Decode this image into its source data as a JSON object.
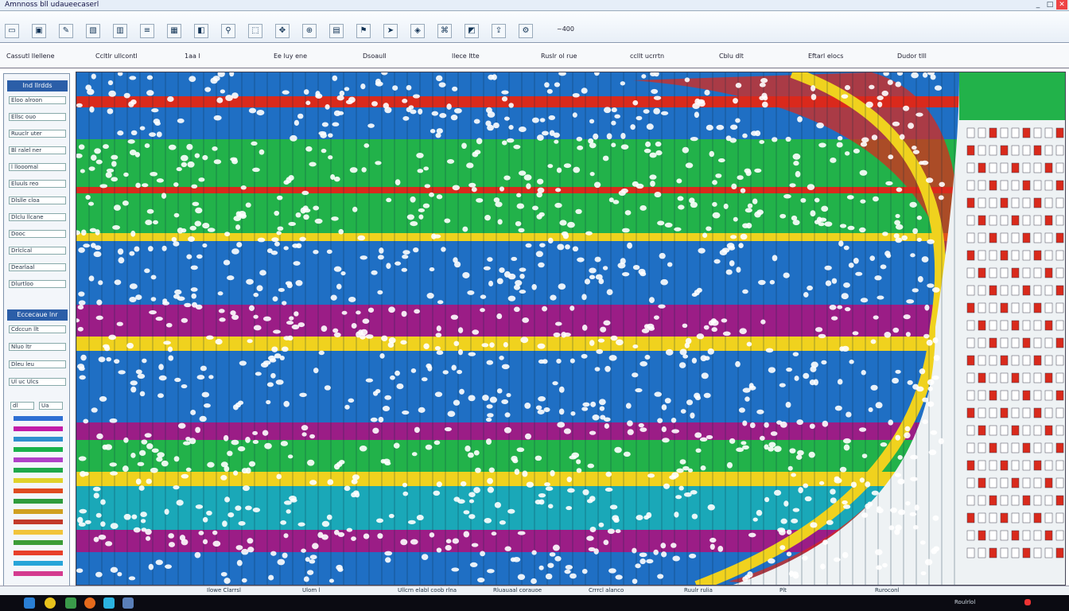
{
  "app": {
    "title": "Amnnoss bll udaueecaserl"
  },
  "window_controls": {
    "minimize": "_",
    "maximize": "□",
    "close": "✕"
  },
  "toolbar": {
    "buttons": [
      {
        "name": "new-icon",
        "glyph": "▭"
      },
      {
        "name": "save-icon",
        "glyph": "▣"
      },
      {
        "name": "pen-icon",
        "glyph": "✎"
      },
      {
        "name": "image-icon",
        "glyph": "▧"
      },
      {
        "name": "chart-icon",
        "glyph": "▥"
      },
      {
        "name": "layers-icon",
        "glyph": "≡"
      },
      {
        "name": "grid-icon",
        "glyph": "▦"
      },
      {
        "name": "paint-icon",
        "glyph": "◧"
      },
      {
        "name": "link-icon",
        "glyph": "⚲"
      },
      {
        "name": "select-icon",
        "glyph": "⬚"
      },
      {
        "name": "move-icon",
        "glyph": "✥"
      },
      {
        "name": "zoom-icon",
        "glyph": "⊕"
      },
      {
        "name": "table-icon",
        "glyph": "▤"
      },
      {
        "name": "flag-icon",
        "glyph": "⚑"
      },
      {
        "name": "arrow-icon",
        "glyph": "➤"
      },
      {
        "name": "color-icon",
        "glyph": "◈"
      },
      {
        "name": "filter-icon",
        "glyph": "⌘"
      },
      {
        "name": "plot-icon",
        "glyph": "◩"
      },
      {
        "name": "export-icon",
        "glyph": "⇪"
      },
      {
        "name": "tool-icon",
        "glyph": "⚙"
      }
    ],
    "readout": "~400"
  },
  "ruler": {
    "labels": [
      "Cassutl llellene",
      "Ccltlr ullcontl",
      "1aa l",
      "Ee luy ene",
      "Dsoaull",
      "llece ltte",
      "Ruslr ol rue",
      "ccllt ucrrtn",
      "Cblu dlt",
      "Eftarl elocs",
      "Dudor tlll"
    ]
  },
  "left_panel": {
    "header": "Ind llrdds",
    "rows": [
      "Eloo alroon",
      "Ellsc ouo",
      "Ruuclr uter",
      "Bl ralel ner",
      "l llooomal",
      "Eluuls reo",
      "Dlslle cloa",
      "Dlclu llcane",
      "Dooc",
      "Drlclcal",
      "Dearlaal",
      "Dlurtloo"
    ],
    "header2": "Eccecaue lnr",
    "rows2": [
      "Cdccun llt",
      "Nluo ltr",
      "Dleu leu",
      "Ul uc Ulcs"
    ],
    "legend_cols": [
      "dl",
      "Ua"
    ],
    "swatches": [
      "#2e6fd3",
      "#c21ca8",
      "#2f8fcf",
      "#19b24b",
      "#b040c8",
      "#1fa84a",
      "#e0d22a",
      "#e04b1f",
      "#2f9c3c",
      "#d0a020",
      "#c33a2a",
      "#f1c43b",
      "#3c9c36",
      "#e8402a",
      "#27a4d8",
      "#d43b8f"
    ]
  },
  "status": {
    "items": [
      "Ilowe Clarrsl",
      "Ulom l",
      "Ullcrn elabl coob rlna",
      "Rluauaal corauoe",
      "Crrrcl alanco",
      "Ruulr rulia",
      "Plt",
      "Ruroconl"
    ],
    "tray_time": "Roulrlol"
  },
  "colors": {
    "blue": "#1f6fc4",
    "green": "#22b24a",
    "red": "#d92a1c",
    "yellow": "#f0d21e",
    "magenta": "#9b1d86",
    "teal": "#1aa8b8",
    "accent": "#2b5ea8"
  }
}
